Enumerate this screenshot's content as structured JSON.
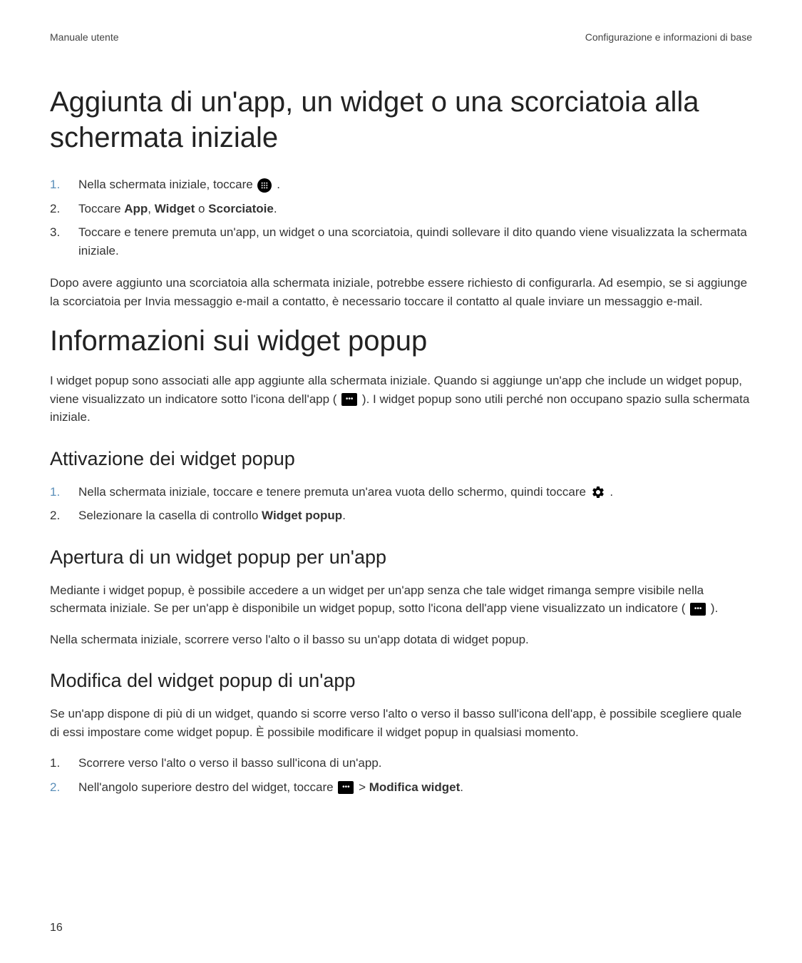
{
  "header": {
    "left": "Manuale utente",
    "right": "Configurazione e informazioni di base"
  },
  "section1": {
    "title": "Aggiunta di un'app, un widget o una scorciatoia alla schermata iniziale",
    "steps": {
      "s1_prefix": "Nella schermata iniziale, toccare ",
      "s1_suffix": " .",
      "s2_prefix": "Toccare ",
      "s2_app": "App",
      "s2_c1": ", ",
      "s2_widget": "Widget",
      "s2_c2": " o ",
      "s2_sc": "Scorciatoie",
      "s2_suffix": ".",
      "s3": "Toccare e tenere premuta un'app, un widget o una scorciatoia, quindi sollevare il dito quando viene visualizzata la schermata iniziale."
    },
    "para": "Dopo avere aggiunto una scorciatoia alla schermata iniziale, potrebbe essere richiesto di configurarla. Ad esempio, se si aggiunge la scorciatoia per Invia messaggio e-mail a contatto, è necessario toccare il contatto al quale inviare un messaggio e-mail."
  },
  "section2": {
    "title": "Informazioni sui widget popup",
    "intro_prefix": "I widget popup sono associati alle app aggiunte alla schermata iniziale. Quando si aggiunge un'app che include un widget popup, viene visualizzato un indicatore sotto l'icona dell'app ( ",
    "intro_suffix": " ). I widget popup sono utili perché non occupano spazio sulla schermata iniziale.",
    "sub1": {
      "title": "Attivazione dei widget popup",
      "s1_prefix": "Nella schermata iniziale, toccare e tenere premuta un'area vuota dello schermo, quindi toccare ",
      "s1_suffix": " .",
      "s2_prefix": "Selezionare la casella di controllo ",
      "s2_bold": "Widget popup",
      "s2_suffix": "."
    },
    "sub2": {
      "title": "Apertura di un widget popup per un'app",
      "p1_prefix": "Mediante i widget popup, è possibile accedere a un widget per un'app senza che tale widget rimanga sempre visibile nella schermata iniziale. Se per un'app è disponibile un widget popup, sotto l'icona dell'app viene visualizzato un indicatore ( ",
      "p1_suffix": " ).",
      "p2": "Nella schermata iniziale, scorrere verso l'alto o il basso su un'app dotata di widget popup."
    },
    "sub3": {
      "title": "Modifica del widget popup di un'app",
      "p": "Se un'app dispone di più di un widget, quando si scorre verso l'alto o verso il basso sull'icona dell'app, è possibile scegliere quale di essi impostare come widget popup. È possibile modificare il widget popup in qualsiasi momento.",
      "s1": "Scorrere verso l'alto o verso il basso sull'icona di un'app.",
      "s2_prefix": "Nell'angolo superiore destro del widget, toccare ",
      "s2_gt": "  > ",
      "s2_bold": "Modifica widget",
      "s2_suffix": "."
    }
  },
  "page_number": "16",
  "numbers": {
    "n1": "1.",
    "n2": "2.",
    "n3": "3."
  }
}
